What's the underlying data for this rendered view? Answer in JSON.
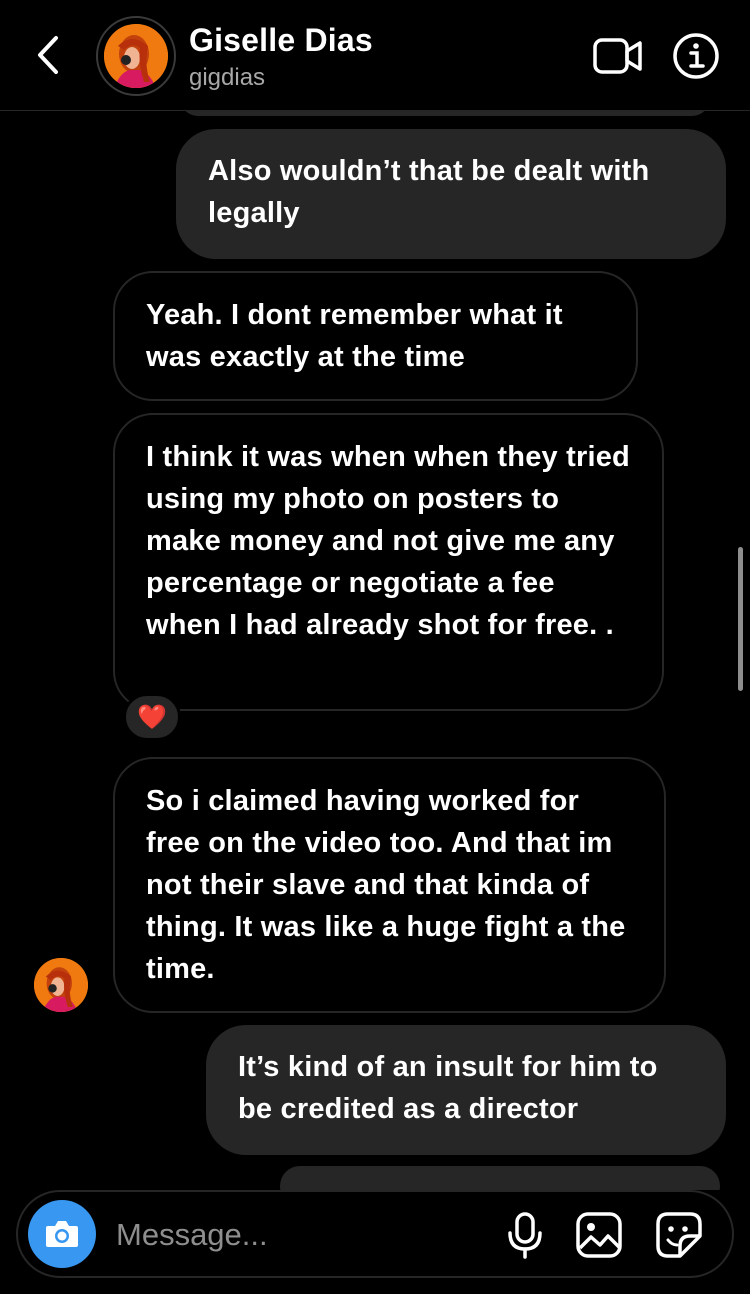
{
  "header": {
    "name": "Giselle Dias",
    "username": "gigdias"
  },
  "messages": [
    {
      "direction": "sent",
      "text": "Also wouldn’t that be dealt with legally"
    },
    {
      "direction": "received",
      "text": "Yeah. I dont remember what it was exactly at the time"
    },
    {
      "direction": "received",
      "text": "I think it was when when they tried using my photo on posters to make money and not give me any percentage or negotiate a fee when I had already shot for free. .",
      "reaction": "❤️"
    },
    {
      "direction": "received",
      "text": "So i claimed having worked for free on the video too. And that im not their slave and that kinda of thing. It was like a huge fight a the time."
    },
    {
      "direction": "sent",
      "text": "It’s kind of an insult for him to be credited as a director"
    }
  ],
  "composer": {
    "placeholder": "Message..."
  },
  "icons": {
    "back": "chevron-left-icon",
    "video": "video-camera-icon",
    "info": "info-icon",
    "camera": "camera-icon",
    "mic": "microphone-icon",
    "gallery": "image-icon",
    "sticker": "sticker-icon"
  },
  "colors": {
    "background": "#000000",
    "sent_bubble": "#262626",
    "received_border": "#262626",
    "accent": "#3897f0",
    "secondary_text": "#a8a8a8",
    "avatar": "#f07a10"
  }
}
